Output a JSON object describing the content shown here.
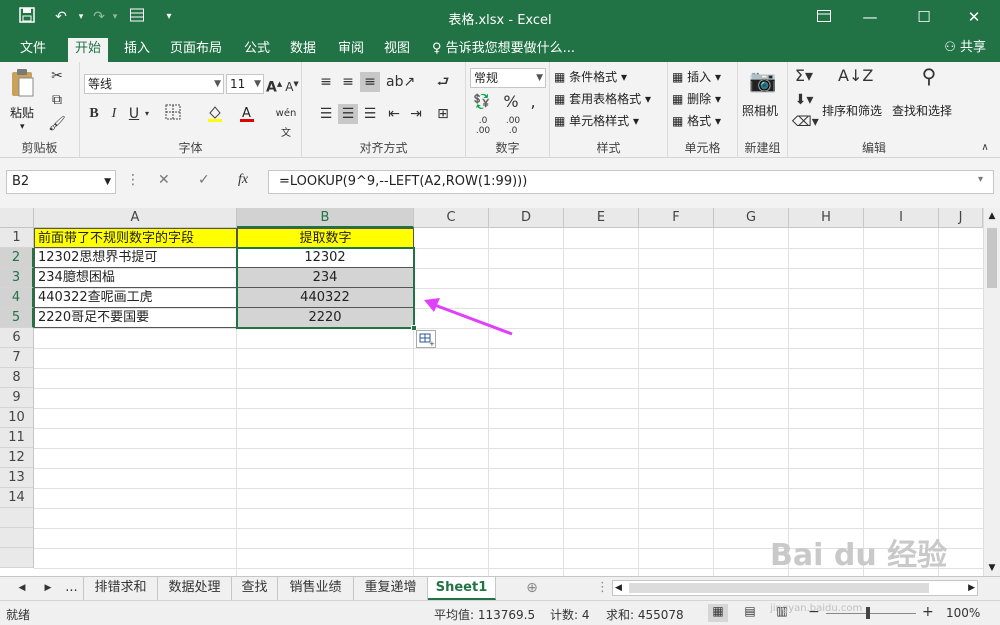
{
  "window": {
    "title": "表格.xlsx - Excel"
  },
  "tabs": [
    "文件",
    "开始",
    "插入",
    "页面布局",
    "公式",
    "数据",
    "审阅",
    "视图"
  ],
  "active_tab": "开始",
  "tell_me": "告诉我您想要做什么...",
  "share": "共享",
  "ribbon": {
    "clipboard": {
      "paste": "粘贴",
      "label": "剪贴板"
    },
    "font": {
      "name": "等线",
      "size": "11",
      "bold": "B",
      "italic": "I",
      "underline": "U",
      "label": "字体"
    },
    "align": {
      "label": "对齐方式"
    },
    "number": {
      "format": "常规",
      "label": "数字"
    },
    "styles": {
      "cond": "条件格式",
      "table": "套用表格格式",
      "cell": "单元格样式",
      "label": "样式"
    },
    "cells": {
      "insert": "插入",
      "delete": "删除",
      "format": "格式",
      "label": "单元格"
    },
    "newgroup": {
      "camera": "照相机",
      "label": "新建组"
    },
    "edit": {
      "sort": "排序和筛选",
      "find": "查找和选择",
      "label": "编辑"
    }
  },
  "formula_bar": {
    "name_box": "B2",
    "formula": "=LOOKUP(9^9,--LEFT(A2,ROW(1:99)))"
  },
  "columns": [
    "A",
    "B",
    "C",
    "D",
    "E",
    "F",
    "G",
    "H",
    "I",
    "J"
  ],
  "rows": [
    "1",
    "2",
    "3",
    "4",
    "5",
    "6",
    "7",
    "8",
    "9",
    "10",
    "11",
    "12",
    "13",
    "14"
  ],
  "cells": {
    "a1": "前面带了不规则数字的字段",
    "b1": "提取数字",
    "a2": "12302思想界书提可",
    "b2": "12302",
    "a3": "234臆想困榀",
    "b3": "234",
    "a4": "440322查呢画工虎",
    "b4": "440322",
    "a5": "2220哥足不要国要",
    "b5": "2220"
  },
  "sheets": [
    "...",
    "排错求和",
    "数据处理",
    "查找",
    "销售业绩",
    "重复递增",
    "Sheet1"
  ],
  "active_sheet": "Sheet1",
  "status": {
    "ready": "就绪",
    "average": "平均值: 113769.5",
    "count": "计数: 4",
    "sum": "求和: 455078",
    "zoom": "100%"
  },
  "watermark": {
    "brand": "Bai du 经验",
    "url": "jingyan.baidu.com"
  },
  "colors": {
    "excel_green": "#217346",
    "header_yellow": "#ffff00",
    "selection_gray": "#d4d4d4",
    "arrow": "#e040fb"
  }
}
